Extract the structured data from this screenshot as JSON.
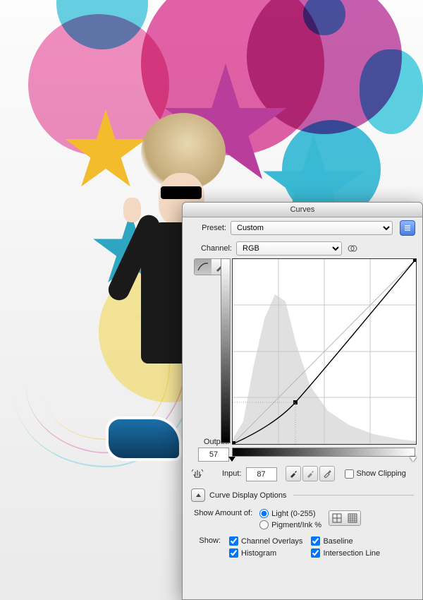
{
  "dialog": {
    "title": "Curves",
    "preset_label": "Preset:",
    "preset_value": "Custom",
    "channel_label": "Channel:",
    "channel_value": "RGB",
    "output_label": "Output:",
    "output_value": "57",
    "input_label": "Input:",
    "input_value": "87",
    "show_clipping_label": "Show Clipping",
    "show_clipping_checked": false,
    "disclosure_label": "Curve Display Options",
    "amount_label": "Show Amount of:",
    "amount_options": [
      {
        "label": "Light  (0-255)",
        "checked": true
      },
      {
        "label": "Pigment/Ink %",
        "checked": false
      }
    ],
    "show_label": "Show:",
    "show_checks": {
      "channel_overlays": {
        "label": "Channel Overlays",
        "checked": true
      },
      "histogram": {
        "label": "Histogram",
        "checked": true
      },
      "baseline": {
        "label": "Baseline",
        "checked": true
      },
      "intersection": {
        "label": "Intersection Line",
        "checked": true
      }
    }
  },
  "chart_data": {
    "type": "line",
    "title": "Curves",
    "xlabel": "Input",
    "ylabel": "Output",
    "xlim": [
      0,
      255
    ],
    "ylim": [
      0,
      255
    ],
    "grid": true,
    "series": [
      {
        "name": "baseline",
        "x": [
          0,
          255
        ],
        "y": [
          0,
          255
        ]
      },
      {
        "name": "curve",
        "x": [
          0,
          87,
          255
        ],
        "y": [
          0,
          57,
          255
        ]
      }
    ],
    "control_points": [
      {
        "input": 0,
        "output": 0
      },
      {
        "input": 87,
        "output": 57
      },
      {
        "input": 255,
        "output": 255
      }
    ],
    "histogram": {
      "x": [
        0,
        16,
        32,
        48,
        64,
        80,
        96,
        112,
        128,
        144,
        160,
        176,
        192,
        208,
        224,
        240,
        255
      ],
      "y": [
        5,
        30,
        120,
        180,
        210,
        180,
        120,
        70,
        45,
        30,
        20,
        14,
        10,
        7,
        5,
        3,
        2
      ]
    }
  }
}
